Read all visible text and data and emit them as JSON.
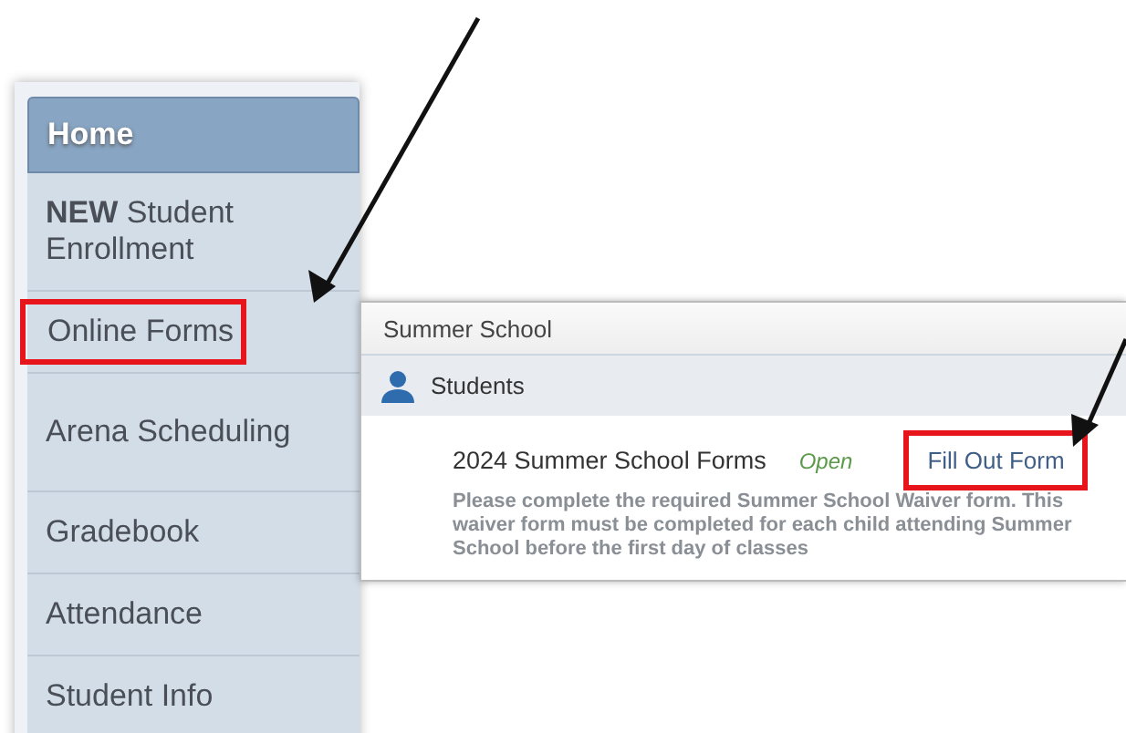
{
  "sidebar": {
    "items": [
      {
        "label": "Home",
        "selected": true,
        "annotated": false
      },
      {
        "label": "**NEW** Student Enrollment",
        "selected": false,
        "annotated": false
      },
      {
        "label": "Online Forms",
        "selected": false,
        "annotated": true
      },
      {
        "label": "Arena Scheduling",
        "selected": false,
        "annotated": false
      },
      {
        "label": "Gradebook",
        "selected": false,
        "annotated": false
      },
      {
        "label": "Attendance",
        "selected": false,
        "annotated": false
      },
      {
        "label": "Student Info",
        "selected": false,
        "annotated": false
      }
    ]
  },
  "forms_panel": {
    "title": "Summer School",
    "group": "Students",
    "forms": [
      {
        "name": "2024 Summer School Forms",
        "status": "Open",
        "action": "Fill Out Form",
        "annotated": true,
        "description": "Please complete the required Summer School Waiver form. This waiver form must be completed for each child attending Summer School before the first day of classes"
      }
    ]
  }
}
